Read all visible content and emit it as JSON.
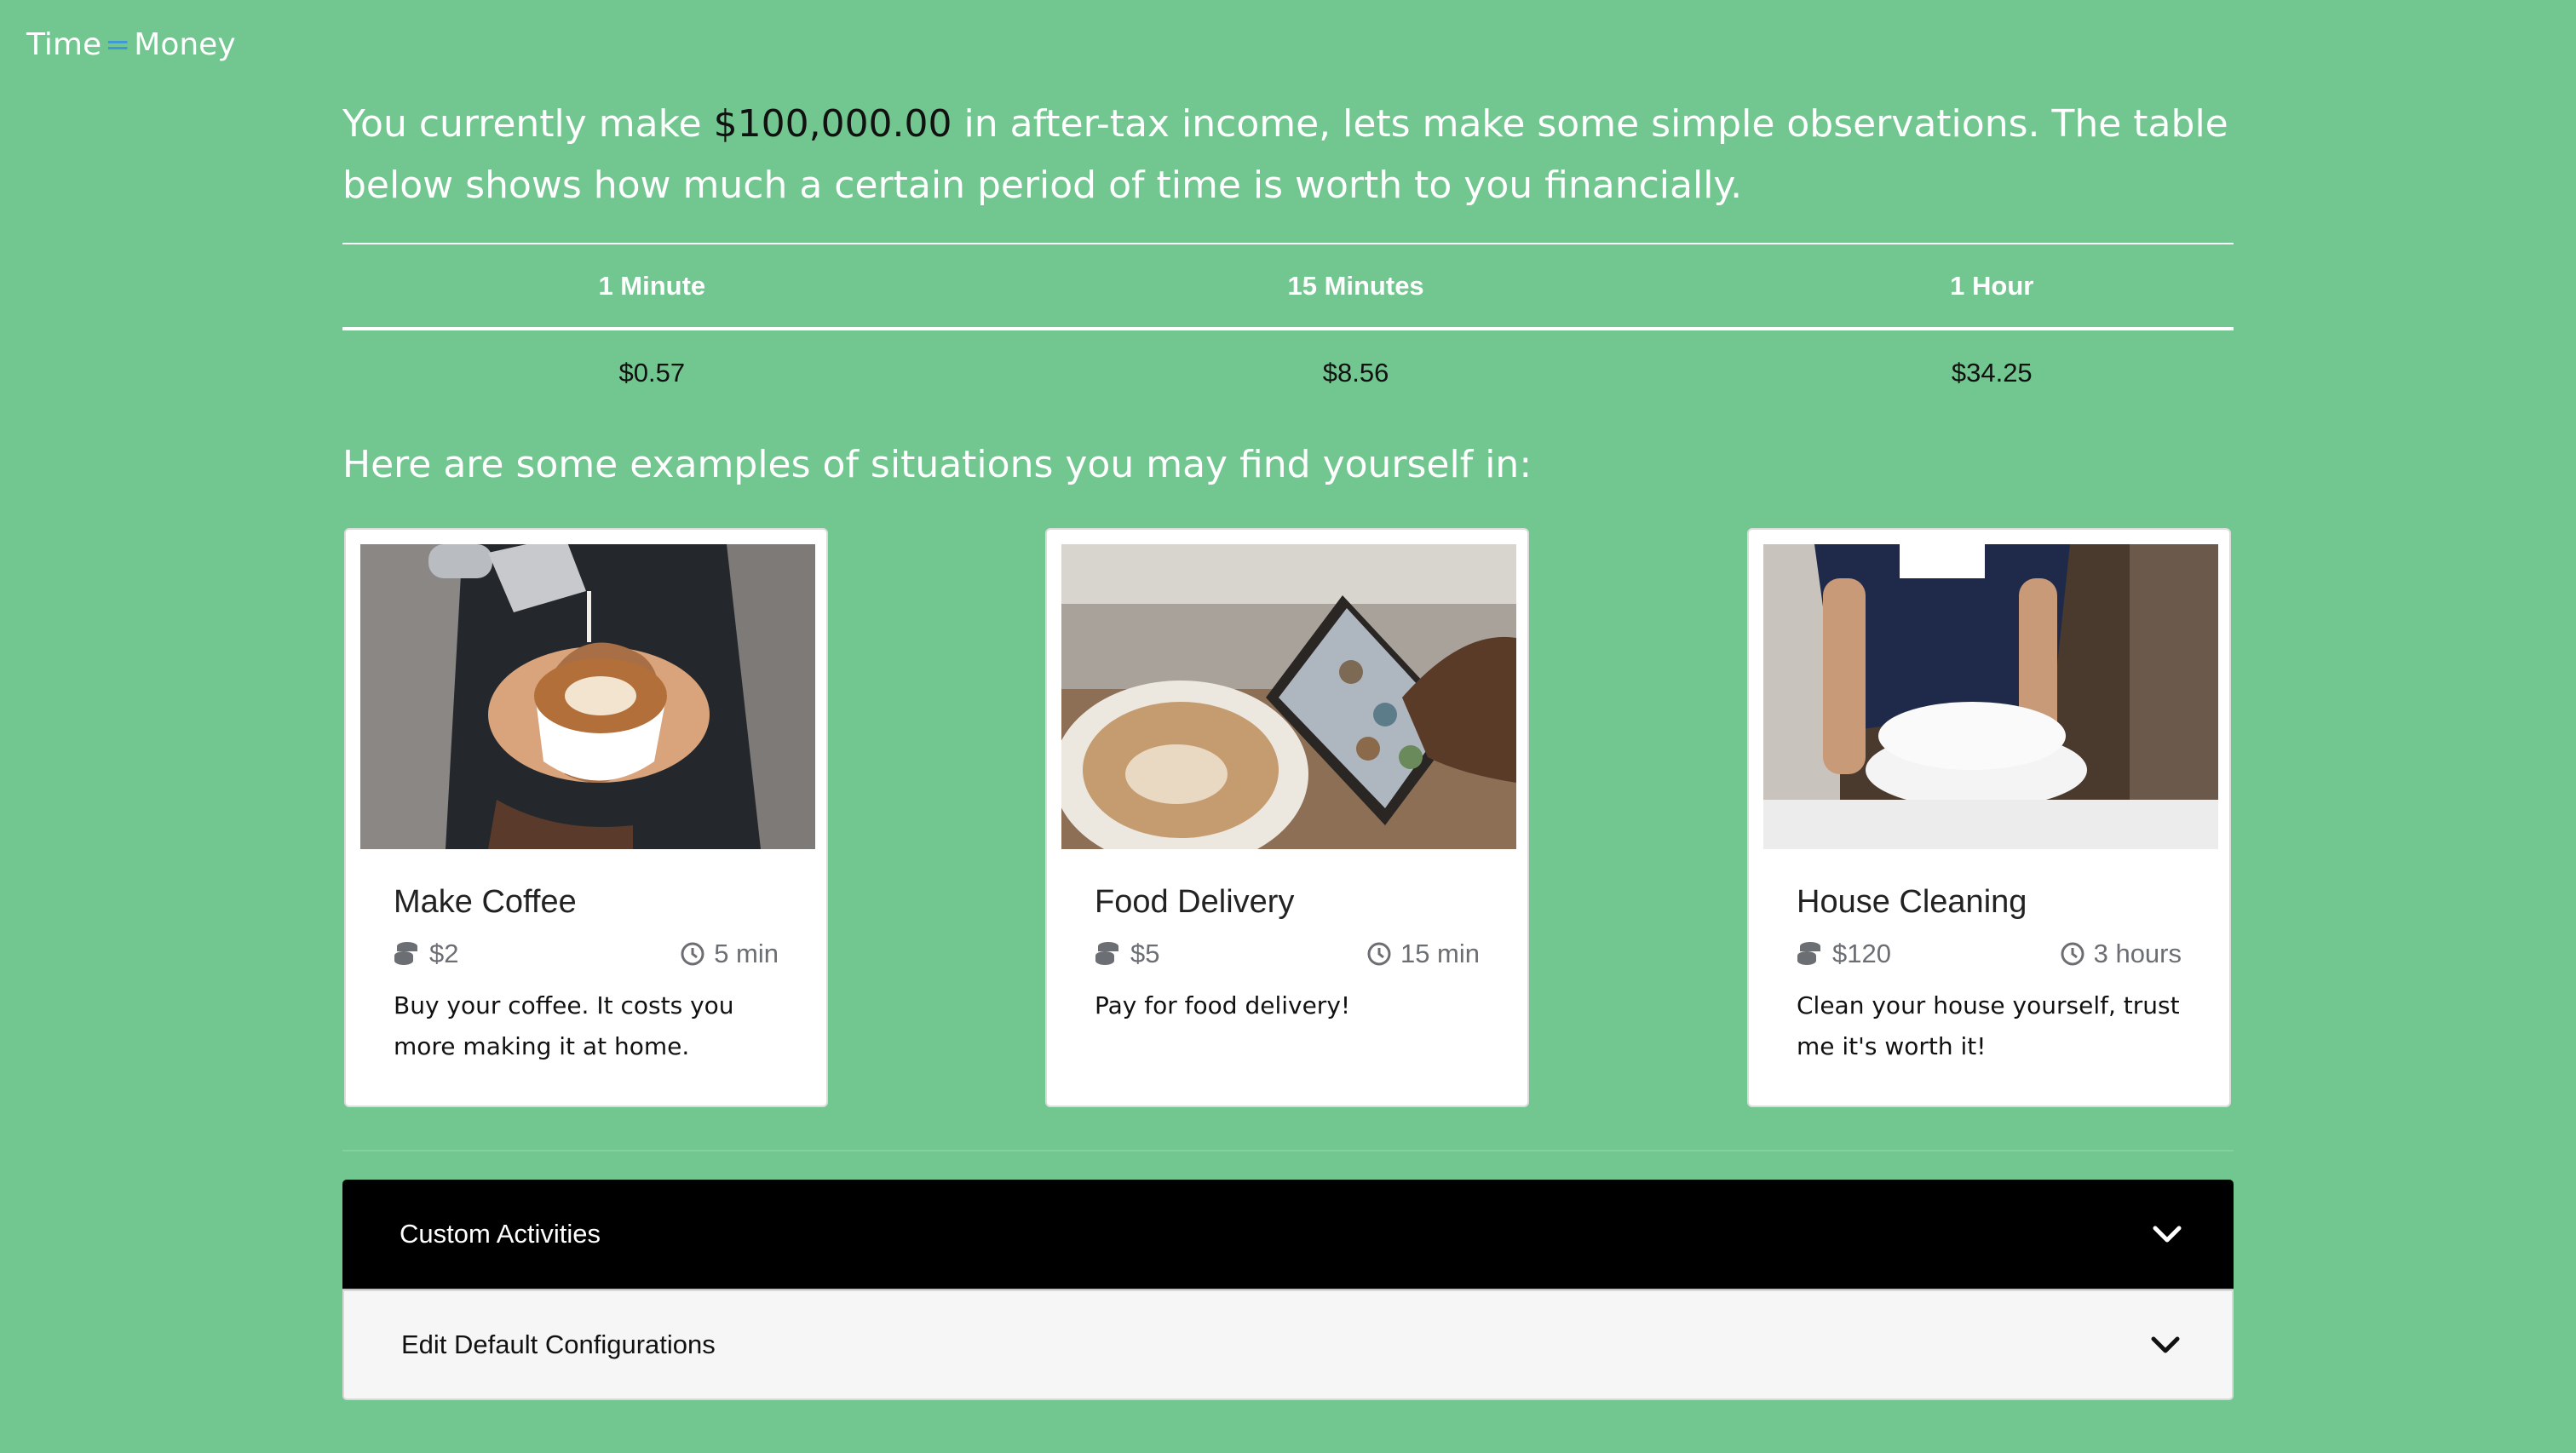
{
  "brand": {
    "time": "Time",
    "eq": "=",
    "money": "Money"
  },
  "intro": {
    "before": "You currently make ",
    "income": "$100,000.00",
    "after": " in after-tax income, lets make some simple observations. The table below shows how much a certain period of time is worth to you financially."
  },
  "table": {
    "headers": [
      "1 Minute",
      "15 Minutes",
      "1 Hour"
    ],
    "values": [
      "$0.57",
      "$8.56",
      "$34.25"
    ]
  },
  "examples_heading": "Here are some examples of situations you may find yourself in:",
  "cards": [
    {
      "title": "Make Coffee",
      "price": "$2",
      "time": "5 min",
      "desc": "Buy your coffee. It costs you more making it at home."
    },
    {
      "title": "Food Delivery",
      "price": "$5",
      "time": "15 min",
      "desc": "Pay for food delivery!"
    },
    {
      "title": "House Cleaning",
      "price": "$120",
      "time": "3 hours",
      "desc": "Clean your house yourself, trust me it's worth it!"
    }
  ],
  "accordion": {
    "custom_label": "Custom Activities",
    "edit_label": "Edit Default Configurations"
  },
  "icons": {
    "price": "coins-icon",
    "time": "clock-icon",
    "expand": "chevron-down-icon"
  },
  "colors": {
    "background": "#72c68f",
    "brand_eq": "#3f97d9",
    "accordion_active": "#000000"
  }
}
